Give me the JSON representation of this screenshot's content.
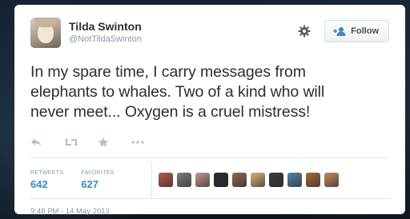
{
  "tweet": {
    "author": {
      "display_name": "Tilda Swinton",
      "handle": "@NotTildaSwinton"
    },
    "follow_label": "Follow",
    "text": "In my spare time, I carry messages from\nelephants to whales.  Two of a kind who will\nnever meet... Oxygen is a cruel mistress!",
    "stats": {
      "retweets_label": "RETWEETS",
      "retweets_count": "642",
      "favorites_label": "FAVORITES",
      "favorites_count": "627"
    },
    "timestamp": "9:48 PM - 14 May 2013"
  },
  "icons": {
    "actions": [
      "reply-icon",
      "retweet-icon",
      "favorite-icon",
      "more-icon"
    ],
    "header": [
      "gear-icon",
      "add-user-icon"
    ]
  },
  "colors": {
    "accent_blue": "#3b88c3",
    "text": "#292f33",
    "muted": "#8899a6",
    "background": "#0f1720"
  },
  "favoriters": [
    {
      "color": "#b65a4a"
    },
    {
      "color": "#7a7f86"
    },
    {
      "color": "#c49a8a"
    },
    {
      "color": "#2b2b2b"
    },
    {
      "color": "#8b6a55"
    },
    {
      "color": "#d9b37a"
    },
    {
      "color": "#3e3a3a"
    },
    {
      "color": "#4f86a8"
    },
    {
      "color": "#a8643c"
    },
    {
      "color": "#c58b5e"
    }
  ]
}
